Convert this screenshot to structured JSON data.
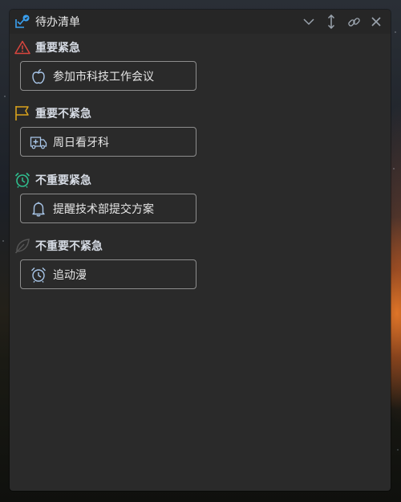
{
  "window": {
    "title": "待办清单",
    "icon": "todo-app-icon"
  },
  "toolbar": {
    "collapse_icon": "chevron-down-icon",
    "resize_icon": "vertical-arrows-icon",
    "pin_icon": "link-icon",
    "close_icon": "close-icon"
  },
  "sections": [
    {
      "label": "重要紧急",
      "icon": "warning-triangle-icon",
      "color": "#d9463e",
      "tasks": [
        {
          "label": "参加市科技工作会议",
          "icon": "apple-icon"
        }
      ]
    },
    {
      "label": "重要不紧急",
      "icon": "flag-icon",
      "color": "#d9a21c",
      "tasks": [
        {
          "label": "周日看牙科",
          "icon": "ambulance-icon"
        }
      ]
    },
    {
      "label": "不重要紧急",
      "icon": "alarm-clock-icon",
      "color": "#2fbf8f",
      "tasks": [
        {
          "label": "提醒技术部提交方案",
          "icon": "bell-icon"
        }
      ]
    },
    {
      "label": "不重要不紧急",
      "icon": "leaf-icon",
      "color": "#555555",
      "tasks": [
        {
          "label": "追动漫",
          "icon": "alarm-clock-icon"
        }
      ]
    }
  ],
  "colors": {
    "panel_bg": "#2a2a2a",
    "accent": "#3aa0f0",
    "task_border": "#8d8d8d",
    "task_icon": "#a9c7ea"
  }
}
